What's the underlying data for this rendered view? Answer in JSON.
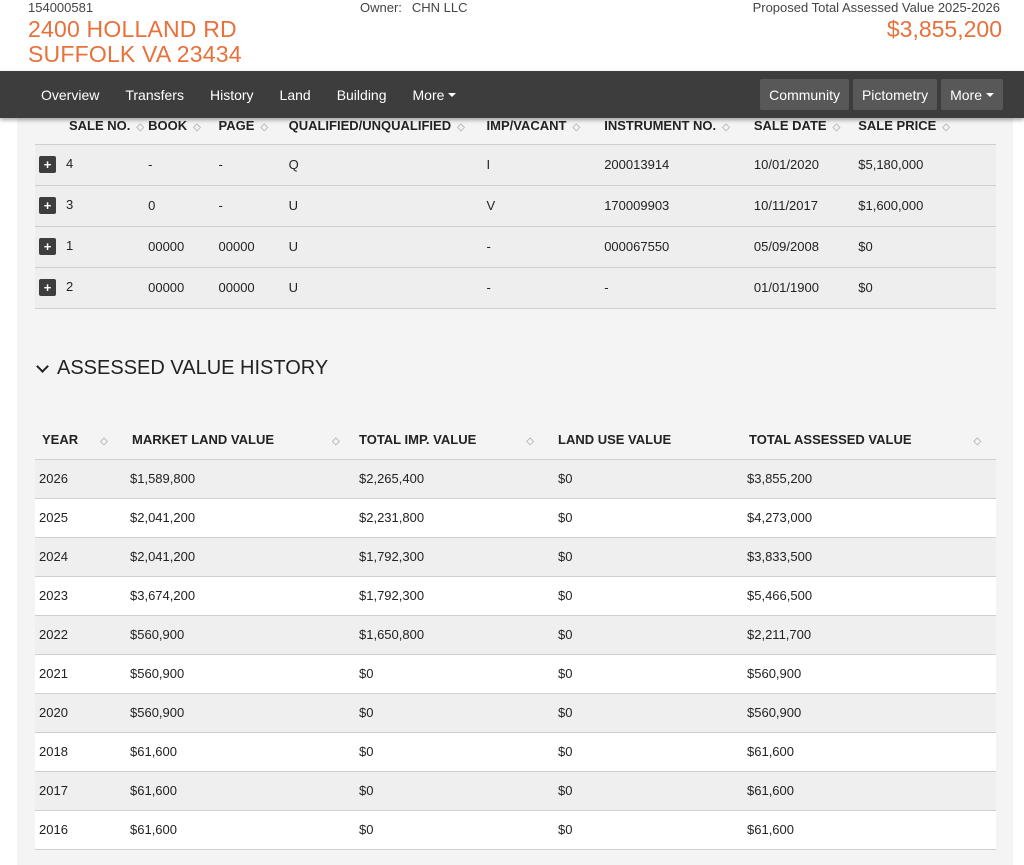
{
  "header": {
    "parcel_id": "154000581",
    "address_line1": "2400 HOLLAND RD",
    "address_line2": "SUFFOLK VA 23434",
    "owner_label": "Owner:",
    "owner_name": "CHN LLC",
    "proposed_label": "Proposed Total Assessed Value 2025-2026",
    "proposed_value": "$3,855,200"
  },
  "nav": {
    "items": [
      "Overview",
      "Transfers",
      "History",
      "Land",
      "Building",
      "More"
    ],
    "right_buttons": [
      "Community",
      "Pictometry",
      "More"
    ]
  },
  "sales": {
    "headers": [
      "SALE NO.",
      "BOOK",
      "PAGE",
      "QUALIFIED/UNQUALIFIED",
      "IMP/VACANT",
      "INSTRUMENT NO.",
      "SALE DATE",
      "SALE PRICE"
    ],
    "rows": [
      [
        "4",
        "-",
        "-",
        "Q",
        "I",
        "200013914",
        "10/01/2020",
        "$5,180,000"
      ],
      [
        "3",
        "0",
        "-",
        "U",
        "V",
        "170009903",
        "10/11/2017",
        "$1,600,000"
      ],
      [
        "1",
        "00000",
        "00000",
        "U",
        "-",
        "000067550",
        "05/09/2008",
        "$0"
      ],
      [
        "2",
        "00000",
        "00000",
        "U",
        "-",
        "-",
        "01/01/1900",
        "$0"
      ]
    ]
  },
  "assessed_history": {
    "title": "ASSESSED VALUE HISTORY",
    "headers": [
      "YEAR",
      "MARKET LAND VALUE",
      "TOTAL IMP. VALUE",
      "LAND USE VALUE",
      "TOTAL ASSESSED VALUE"
    ],
    "rows": [
      [
        "2026",
        "$1,589,800",
        "$2,265,400",
        "$0",
        "$3,855,200"
      ],
      [
        "2025",
        "$2,041,200",
        "$2,231,800",
        "$0",
        "$4,273,000"
      ],
      [
        "2024",
        "$2,041,200",
        "$1,792,300",
        "$0",
        "$3,833,500"
      ],
      [
        "2023",
        "$3,674,200",
        "$1,792,300",
        "$0",
        "$5,466,500"
      ],
      [
        "2022",
        "$560,900",
        "$1,650,800",
        "$0",
        "$2,211,700"
      ],
      [
        "2021",
        "$560,900",
        "$0",
        "$0",
        "$560,900"
      ],
      [
        "2020",
        "$560,900",
        "$0",
        "$0",
        "$560,900"
      ],
      [
        "2018",
        "$61,600",
        "$0",
        "$0",
        "$61,600"
      ],
      [
        "2017",
        "$61,600",
        "$0",
        "$0",
        "$61,600"
      ],
      [
        "2016",
        "$61,600",
        "$0",
        "$0",
        "$61,600"
      ]
    ]
  },
  "colors": {
    "accent": "#e8703a",
    "navbar": "#3d3d3d",
    "nav_button": "#585858"
  }
}
